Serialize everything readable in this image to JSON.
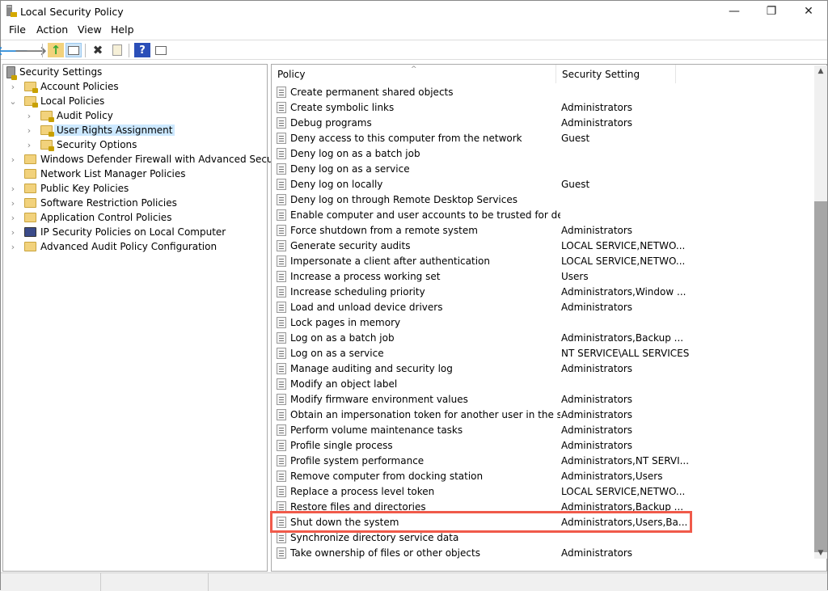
{
  "window": {
    "title": "Local Security Policy",
    "minimize": "—",
    "maximize": "❐",
    "close": "✕"
  },
  "menu": [
    "File",
    "Action",
    "View",
    "Help"
  ],
  "toolbar": {
    "back": "🡐",
    "forward": "🡒",
    "up": "↑",
    "delete": "✖",
    "help": "?"
  },
  "tree": [
    {
      "label": "Security Settings",
      "level": 0,
      "chev": "",
      "icon": "server-lock"
    },
    {
      "label": "Account Policies",
      "level": 1,
      "chev": "›",
      "icon": "folder-lock"
    },
    {
      "label": "Local Policies",
      "level": 1,
      "chev": "⌄",
      "icon": "folder-lock"
    },
    {
      "label": "Audit Policy",
      "level": 2,
      "chev": "›",
      "icon": "folder-lock"
    },
    {
      "label": "User Rights Assignment",
      "level": 2,
      "chev": "›",
      "icon": "folder-lock",
      "selected": true
    },
    {
      "label": "Security Options",
      "level": 2,
      "chev": "›",
      "icon": "folder-lock"
    },
    {
      "label": "Windows Defender Firewall with Advanced Security",
      "level": 1,
      "chev": "›",
      "icon": "folder"
    },
    {
      "label": "Network List Manager Policies",
      "level": 1,
      "chev": "",
      "icon": "folder"
    },
    {
      "label": "Public Key Policies",
      "level": 1,
      "chev": "›",
      "icon": "folder"
    },
    {
      "label": "Software Restriction Policies",
      "level": 1,
      "chev": "›",
      "icon": "folder"
    },
    {
      "label": "Application Control Policies",
      "level": 1,
      "chev": "›",
      "icon": "folder"
    },
    {
      "label": "IP Security Policies on Local Computer",
      "level": 1,
      "chev": "›",
      "icon": "computer-key"
    },
    {
      "label": "Advanced Audit Policy Configuration",
      "level": 1,
      "chev": "›",
      "icon": "folder"
    }
  ],
  "list": {
    "columns": [
      "Policy",
      "Security Setting"
    ],
    "scroll_fraction": 0.72,
    "highlighted": "Shut down the system",
    "rows": [
      {
        "policy": "Create permanent shared objects",
        "setting": ""
      },
      {
        "policy": "Create symbolic links",
        "setting": "Administrators"
      },
      {
        "policy": "Debug programs",
        "setting": "Administrators"
      },
      {
        "policy": "Deny access to this computer from the network",
        "setting": "Guest"
      },
      {
        "policy": "Deny log on as a batch job",
        "setting": ""
      },
      {
        "policy": "Deny log on as a service",
        "setting": ""
      },
      {
        "policy": "Deny log on locally",
        "setting": "Guest"
      },
      {
        "policy": "Deny log on through Remote Desktop Services",
        "setting": ""
      },
      {
        "policy": "Enable computer and user accounts to be trusted for delega...",
        "setting": ""
      },
      {
        "policy": "Force shutdown from a remote system",
        "setting": "Administrators"
      },
      {
        "policy": "Generate security audits",
        "setting": "LOCAL SERVICE,NETWO..."
      },
      {
        "policy": "Impersonate a client after authentication",
        "setting": "LOCAL SERVICE,NETWO..."
      },
      {
        "policy": "Increase a process working set",
        "setting": "Users"
      },
      {
        "policy": "Increase scheduling priority",
        "setting": "Administrators,Window ..."
      },
      {
        "policy": "Load and unload device drivers",
        "setting": "Administrators"
      },
      {
        "policy": "Lock pages in memory",
        "setting": ""
      },
      {
        "policy": "Log on as a batch job",
        "setting": "Administrators,Backup ..."
      },
      {
        "policy": "Log on as a service",
        "setting": "NT SERVICE\\ALL SERVICES"
      },
      {
        "policy": "Manage auditing and security log",
        "setting": "Administrators"
      },
      {
        "policy": "Modify an object label",
        "setting": ""
      },
      {
        "policy": "Modify firmware environment values",
        "setting": "Administrators"
      },
      {
        "policy": "Obtain an impersonation token for another user in the same...",
        "setting": "Administrators"
      },
      {
        "policy": "Perform volume maintenance tasks",
        "setting": "Administrators"
      },
      {
        "policy": "Profile single process",
        "setting": "Administrators"
      },
      {
        "policy": "Profile system performance",
        "setting": "Administrators,NT SERVI..."
      },
      {
        "policy": "Remove computer from docking station",
        "setting": "Administrators,Users"
      },
      {
        "policy": "Replace a process level token",
        "setting": "LOCAL SERVICE,NETWO..."
      },
      {
        "policy": "Restore files and directories",
        "setting": "Administrators,Backup ..."
      },
      {
        "policy": "Shut down the system",
        "setting": "Administrators,Users,Ba..."
      },
      {
        "policy": "Synchronize directory service data",
        "setting": ""
      },
      {
        "policy": "Take ownership of files or other objects",
        "setting": "Administrators"
      }
    ]
  },
  "colors": {
    "highlight": "#f05a4a",
    "selection": "#cce8ff"
  }
}
